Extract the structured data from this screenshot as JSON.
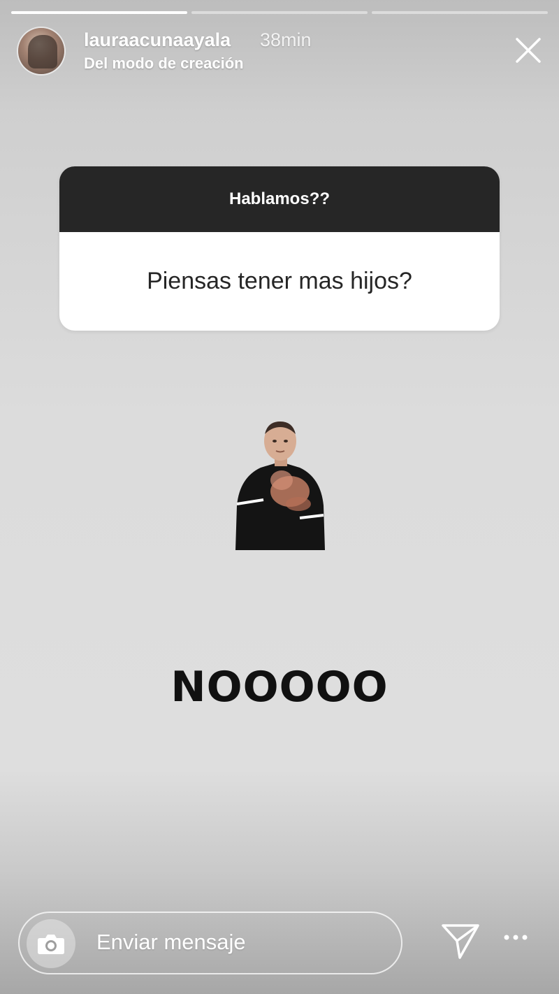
{
  "story": {
    "username": "lauraacunaayala",
    "time": "38min",
    "subtitle": "Del modo de creación",
    "progress_segments": 3,
    "progress_done": 1
  },
  "question_card": {
    "header": "Hablamos??",
    "question": "Piensas tener mas hijos?"
  },
  "sticker": {
    "icon": "waving-man-gif"
  },
  "answer_text": "NOOOOO",
  "footer": {
    "message_placeholder": "Enviar mensaje",
    "camera_icon": "camera-icon",
    "send_icon": "send-icon",
    "more_icon": "more-icon"
  },
  "colors": {
    "card_header_bg": "#262626",
    "card_body_bg": "#ffffff",
    "text_dark": "#111111"
  }
}
